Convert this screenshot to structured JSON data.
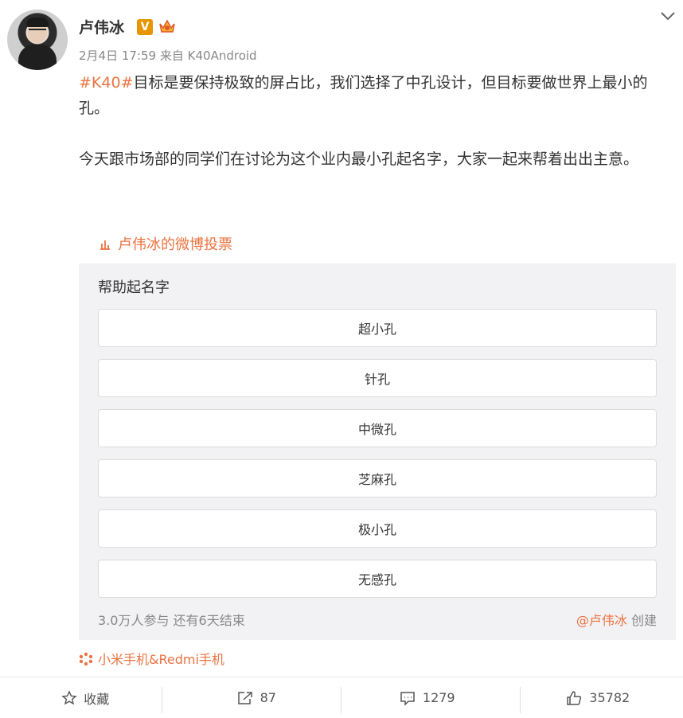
{
  "post": {
    "username": "卢伟冰",
    "verified_badge": "V",
    "date": "2月4日 17:59",
    "source": "来自 K40Android",
    "hashtag": "#K40#",
    "paragraph1": "目标是要保持极致的屏占比，我们选择了中孔设计，但目标要做世界上最小的孔。",
    "paragraph2": "今天跟市场部的同学们在讨论为这个业内最小孔起名字，大家一起来帮着出出主意。"
  },
  "vote_link": "卢伟冰的微博投票",
  "poll": {
    "title": "帮助起名字",
    "options": [
      "超小孔",
      "针孔",
      "中微孔",
      "芝麻孔",
      "极小孔",
      "无感孔"
    ],
    "participation": "3.0万人参与  还有6天结束",
    "creator": "@卢伟冰",
    "created_label": "创建"
  },
  "topic": "小米手机&Redmi手机",
  "actions": {
    "favorite": "收藏",
    "repost": "87",
    "comment": "1279",
    "like": "35782"
  },
  "colors": {
    "accent": "#eb7340",
    "badge": "#e59600",
    "poll_bg": "#f2f2f5"
  },
  "icons": [
    "chevron-down-icon",
    "vote-icon",
    "topic-icon",
    "star-icon",
    "repost-icon",
    "comment-icon",
    "like-icon"
  ]
}
